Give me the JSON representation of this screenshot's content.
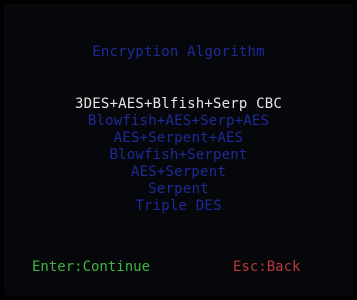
{
  "header": {
    "title": "Encryption Algorithm"
  },
  "menu": {
    "items": [
      {
        "label": "3DES+AES+Blfish+Serp CBC",
        "selected": true
      },
      {
        "label": "Blowfish+AES+Serp+AES",
        "selected": false
      },
      {
        "label": "AES+Serpent+AES",
        "selected": false
      },
      {
        "label": "Blowfish+Serpent",
        "selected": false
      },
      {
        "label": "AES+Serpent",
        "selected": false
      },
      {
        "label": "Serpent",
        "selected": false
      },
      {
        "label": "Triple DES",
        "selected": false
      }
    ]
  },
  "footer": {
    "enter": "Enter:Continue",
    "esc": "Esc:Back"
  },
  "colors": {
    "background": "#000000",
    "title": "#1f2a9a",
    "selected": "#e6e6e6",
    "unselected": "#1f2a9a",
    "enter": "#3fb53f",
    "esc": "#b83a3a"
  }
}
